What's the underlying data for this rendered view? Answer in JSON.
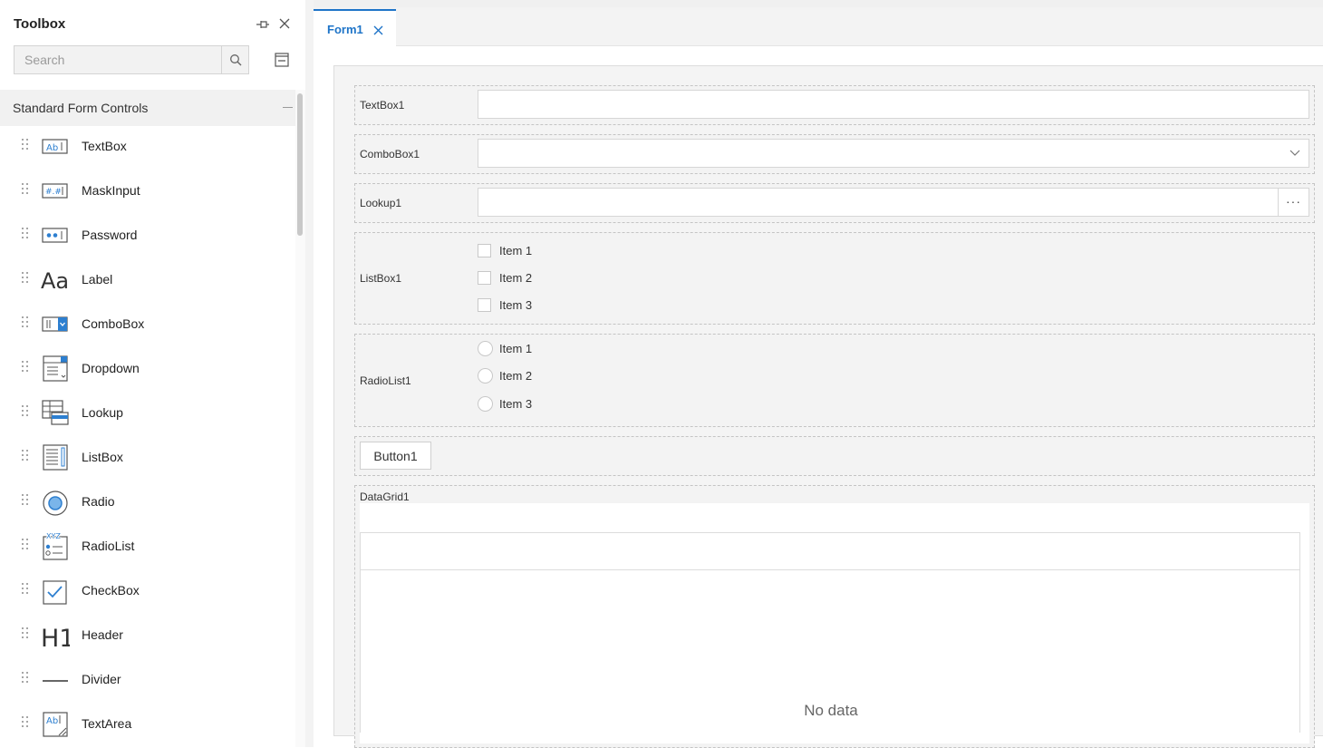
{
  "toolbox": {
    "title": "Toolbox",
    "search_placeholder": "Search",
    "group_title": "Standard Form Controls",
    "items": [
      {
        "label": "TextBox",
        "icon": "textbox-icon"
      },
      {
        "label": "MaskInput",
        "icon": "maskinput-icon"
      },
      {
        "label": "Password",
        "icon": "password-icon"
      },
      {
        "label": "Label",
        "icon": "label-icon"
      },
      {
        "label": "ComboBox",
        "icon": "combobox-icon"
      },
      {
        "label": "Dropdown",
        "icon": "dropdown-icon"
      },
      {
        "label": "Lookup",
        "icon": "lookup-icon"
      },
      {
        "label": "ListBox",
        "icon": "listbox-icon"
      },
      {
        "label": "Radio",
        "icon": "radio-icon"
      },
      {
        "label": "RadioList",
        "icon": "radiolist-icon"
      },
      {
        "label": "CheckBox",
        "icon": "checkbox-icon"
      },
      {
        "label": "Header",
        "icon": "header-icon"
      },
      {
        "label": "Divider",
        "icon": "divider-icon"
      },
      {
        "label": "TextArea",
        "icon": "textarea-icon"
      }
    ]
  },
  "editor": {
    "tab_label": "Form1",
    "form": {
      "textbox_label": "TextBox1",
      "combobox_label": "ComboBox1",
      "lookup_label": "Lookup1",
      "listbox_label": "ListBox1",
      "listbox_items": [
        "Item 1",
        "Item 2",
        "Item 3"
      ],
      "radiolist_label": "RadioList1",
      "radiolist_items": [
        "Item 1",
        "Item 2",
        "Item 3"
      ],
      "button_label": "Button1",
      "datagrid_label": "DataGrid1",
      "datagrid_empty": "No data",
      "lookup_button": "···"
    }
  },
  "colors": {
    "accent": "#1e74c8",
    "panel": "#f4f4f4",
    "border": "#c4c4c4"
  }
}
